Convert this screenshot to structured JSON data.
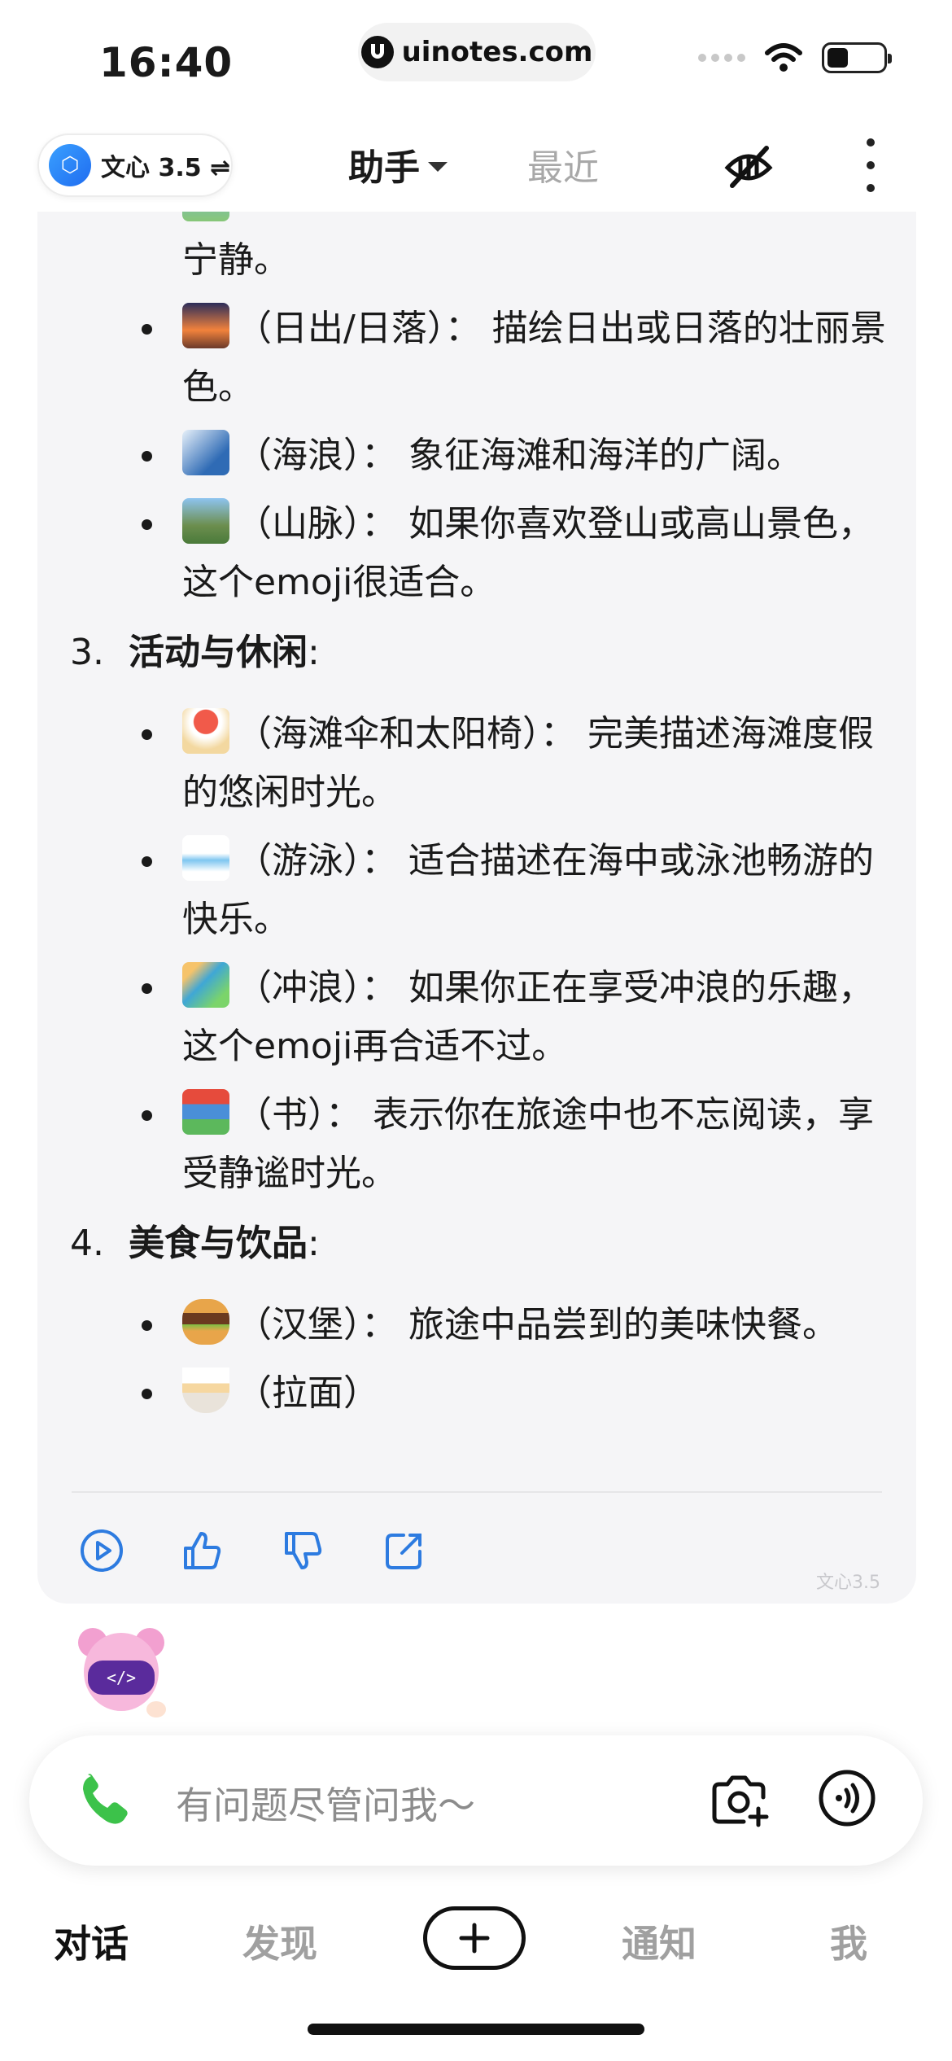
{
  "status_bar": {
    "time": "16:40",
    "url": "uinotes.com"
  },
  "header": {
    "model_label": "文心 3.5 ⇌",
    "tab_assistant": "助手",
    "tab_recent": "最近"
  },
  "message": {
    "partial_top_line": "宁静。",
    "items_nature": [
      {
        "emoji": "sunrise-over-mountains",
        "text": "（日出/日落）： 描绘日出或日落的壮丽景色。"
      },
      {
        "emoji": "water-wave",
        "text": "（海浪）： 象征海滩和海洋的广阔。"
      },
      {
        "emoji": "mountain-landscape",
        "text": "（山脉）： 如果你喜欢登山或高山景色，这个emoji很适合。"
      }
    ],
    "section3": {
      "num": "3.",
      "title": "活动与休闲",
      "colon": ":"
    },
    "items_activity": [
      {
        "emoji": "beach-umbrella",
        "text": "（海滩伞和太阳椅）： 完美描述海滩度假的悠闲时光。"
      },
      {
        "emoji": "swimmer",
        "text": "（游泳）： 适合描述在海中或泳池畅游的快乐。"
      },
      {
        "emoji": "surfer",
        "text": "（冲浪）： 如果你正在享受冲浪的乐趣，这个emoji再合适不过。"
      },
      {
        "emoji": "books",
        "text": "（书）： 表示你在旅途中也不忘阅读，享受静谧时光。"
      }
    ],
    "section4": {
      "num": "4.",
      "title": "美食与饮品",
      "colon": ":"
    },
    "items_food": [
      {
        "emoji": "hamburger",
        "text": "（汉堡）： 旅途中品尝到的美味快餐。"
      },
      {
        "emoji": "ramen",
        "text": "（拉面）"
      }
    ],
    "watermark": "文心3.5"
  },
  "input": {
    "placeholder": "有问题尽管问我～"
  },
  "nav": {
    "chat": "对话",
    "discover": "发现",
    "notify": "通知",
    "me": "我"
  }
}
